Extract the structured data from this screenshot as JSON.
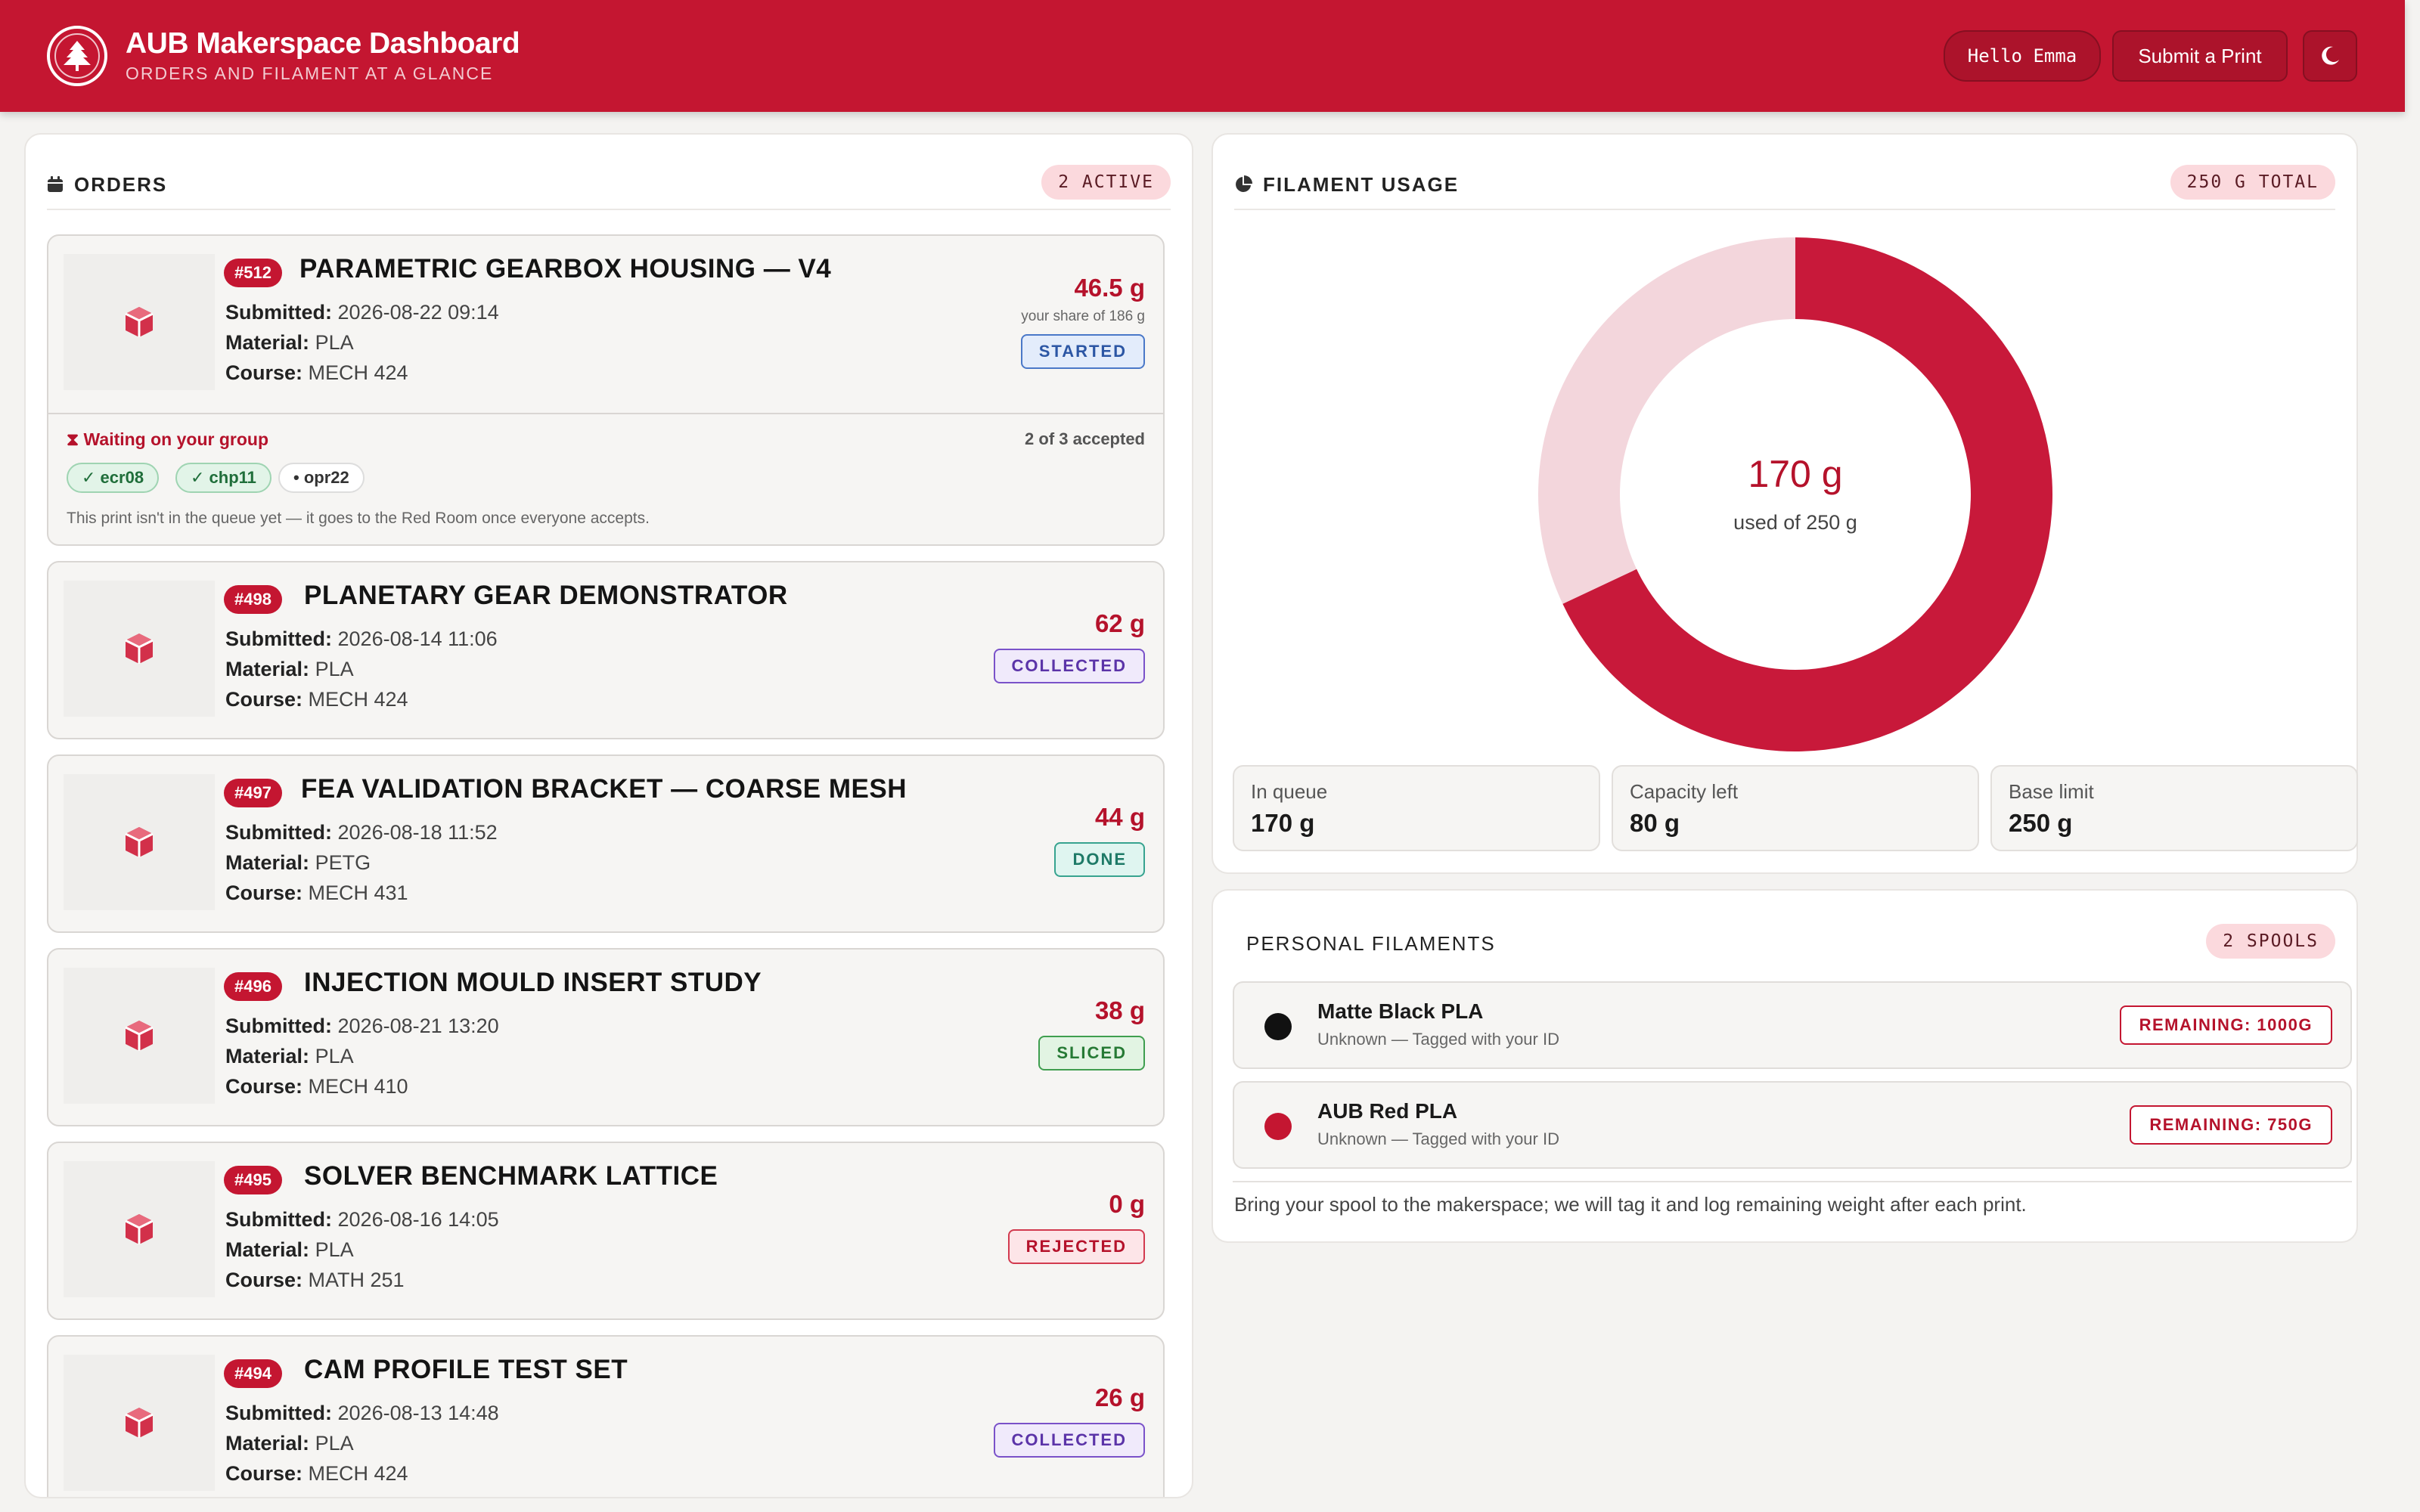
{
  "header": {
    "title": "AUB Makerspace Dashboard",
    "subtitle": "ORDERS AND FILAMENT AT A GLANCE",
    "hello": "Hello Emma",
    "submit_label": "Submit a Print",
    "theme_icon": "moon-icon"
  },
  "orders": {
    "title": "ORDERS",
    "active_pill": "2 ACTIVE",
    "items": [
      {
        "id": "#512",
        "title": "Parametric Gearbox Housing — V4",
        "submitted": "2026-08-22 09:14",
        "material": "PLA",
        "course": "MECH 424",
        "grams": "46.5 g",
        "share": "your share of 186 g",
        "status": "STARTED"
      },
      {
        "id": "#498",
        "title": "Planetary Gear Demonstrator",
        "submitted": "2026-08-14 11:06",
        "material": "PLA",
        "course": "MECH 424",
        "grams": "62 g",
        "status": "COLLECTED"
      },
      {
        "id": "#497",
        "title": "FEA Validation Bracket — Coarse Mesh",
        "submitted": "2026-08-18 11:52",
        "material": "PETG",
        "course": "MECH 431",
        "grams": "44 g",
        "status": "DONE"
      },
      {
        "id": "#496",
        "title": "Injection Mould Insert Study",
        "submitted": "2026-08-21 13:20",
        "material": "PLA",
        "course": "MECH 410",
        "grams": "38 g",
        "status": "SLICED"
      },
      {
        "id": "#495",
        "title": "Solver Benchmark Lattice",
        "submitted": "2026-08-16 14:05",
        "material": "PLA",
        "course": "MATH 251",
        "grams": "0 g",
        "status": "REJECTED"
      },
      {
        "id": "#494",
        "title": "Cam Profile Test Set",
        "submitted": "2026-08-13 14:48",
        "material": "PLA",
        "course": "MECH 424",
        "grams": "26 g",
        "status": "COLLECTED"
      }
    ],
    "labels": {
      "submitted": "Submitted:",
      "material": "Material:",
      "course": "Course:"
    },
    "group": {
      "waiting": "Waiting on your group",
      "accepted": "2 of 3 accepted",
      "members": [
        "✓ ecr08",
        "✓ chp11",
        "• opr22"
      ],
      "note": "This print isn't in the queue yet — it goes to the Red Room once everyone accepts."
    }
  },
  "filament": {
    "title": "FILAMENT USAGE",
    "total_pill": "250 G TOTAL",
    "center_value": "170 g",
    "center_sub": "used of 250 g",
    "stats": [
      {
        "label": "In queue",
        "value": "170 g"
      },
      {
        "label": "Capacity left",
        "value": "80 g"
      },
      {
        "label": "Base limit",
        "value": "250 g"
      }
    ],
    "colors": {
      "used": "#c8193a",
      "left": "#f3d6dc"
    }
  },
  "chart_data": {
    "type": "pie",
    "title": "",
    "categories": [
      "used",
      "left"
    ],
    "values": [
      170,
      80
    ]
  },
  "personal": {
    "title": "PERSONAL FILAMENTS",
    "pill": "2 SPOOLS",
    "spools": [
      {
        "name": "Matte Black PLA",
        "sub": "Unknown — Tagged with your ID",
        "remaining": "REMAINING: 1000G",
        "color": "#111111"
      },
      {
        "name": "AUB Red PLA",
        "sub": "Unknown — Tagged with your ID",
        "remaining": "REMAINING: 750G",
        "color": "#c41631"
      }
    ],
    "note": "Bring your spool to the makerspace; we will tag it and log remaining weight after each print."
  }
}
